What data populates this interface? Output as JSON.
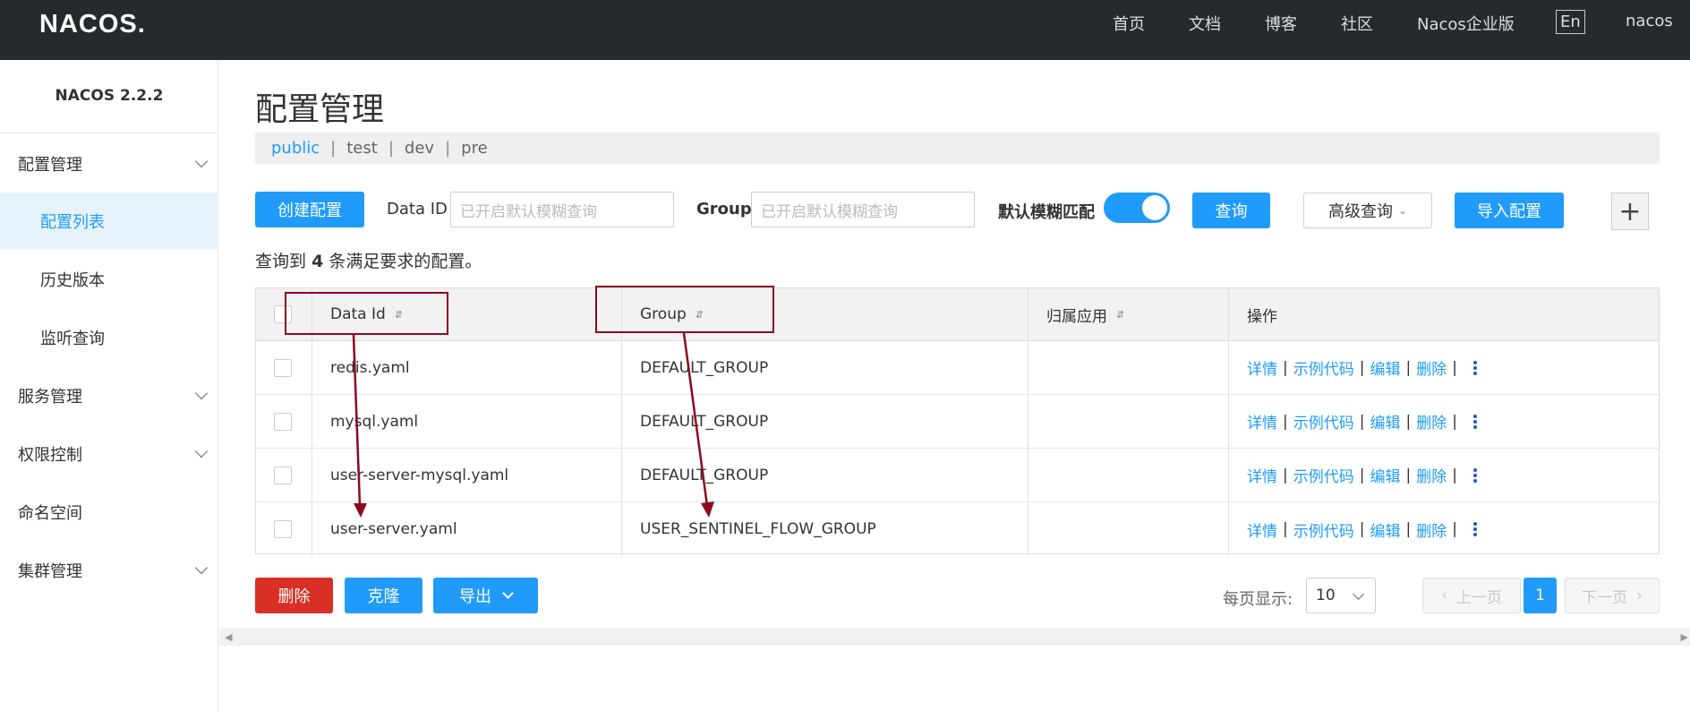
{
  "header": {
    "logo": "NACOS.",
    "nav": [
      "首页",
      "文档",
      "博客",
      "社区",
      "Nacos企业版"
    ],
    "lang": "En",
    "user": "nacos"
  },
  "sidebar": {
    "version": "NACOS 2.2.2",
    "items": [
      {
        "label": "配置管理",
        "expandable": true
      },
      {
        "label": "配置列表",
        "active": true
      },
      {
        "label": "历史版本"
      },
      {
        "label": "监听查询"
      },
      {
        "label": "服务管理",
        "expandable": true
      },
      {
        "label": "权限控制",
        "expandable": true
      },
      {
        "label": "命名空间"
      },
      {
        "label": "集群管理",
        "expandable": true
      }
    ]
  },
  "main": {
    "title": "配置管理",
    "namespaces": [
      "public",
      "test",
      "dev",
      "pre"
    ],
    "toolbar": {
      "create_label": "创建配置",
      "dataid_label": "Data ID",
      "dataid_placeholder": "已开启默认模糊查询",
      "group_label": "Group",
      "group_placeholder": "已开启默认模糊查询",
      "fuzzy_label": "默认模糊匹配",
      "query_label": "查询",
      "advanced_label": "高级查询",
      "import_label": "导入配置",
      "plus_label": "+"
    },
    "result": {
      "prefix": "查询到",
      "count": "4",
      "suffix": "条满足要求的配置。"
    },
    "table": {
      "headers": [
        "Data Id",
        "Group",
        "归属应用",
        "操作"
      ],
      "rows": [
        {
          "data_id": "redis.yaml",
          "group": "DEFAULT_GROUP",
          "app": ""
        },
        {
          "data_id": "mysql.yaml",
          "group": "DEFAULT_GROUP",
          "app": ""
        },
        {
          "data_id": "user-server-mysql.yaml",
          "group": "DEFAULT_GROUP",
          "app": ""
        },
        {
          "data_id": "user-server.yaml",
          "group": "USER_SENTINEL_FLOW_GROUP",
          "app": ""
        }
      ],
      "ops": [
        "详情",
        "示例代码",
        "编辑",
        "删除"
      ]
    },
    "footer": {
      "delete_label": "删除",
      "clone_label": "克隆",
      "export_label": "导出",
      "per_page_label": "每页显示:",
      "per_page_value": "10",
      "prev_label": "上一页",
      "page": "1",
      "next_label": "下一页"
    }
  },
  "colors": {
    "primary": "#209bfa",
    "danger": "#d93026",
    "header_bg": "#252a2f",
    "annotation": "#8b0a1d"
  }
}
